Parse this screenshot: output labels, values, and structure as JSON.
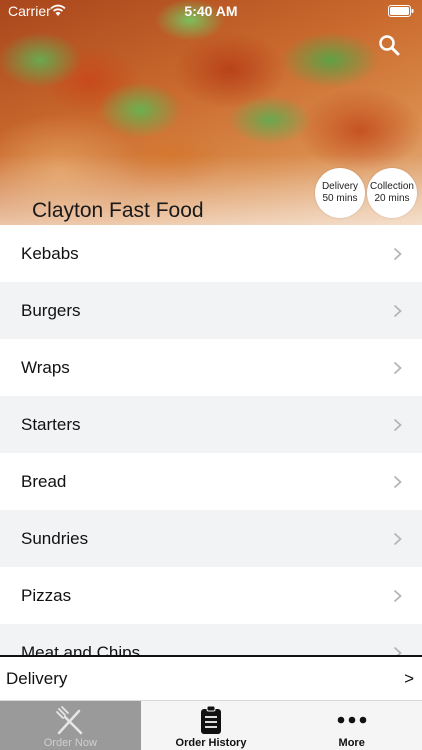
{
  "status_bar": {
    "carrier": "Carrier",
    "time": "5:40 AM"
  },
  "header": {
    "restaurant_name": "Clayton Fast Food",
    "search_icon": "search-icon",
    "delivery_badge": {
      "label": "Delivery",
      "time": "50 mins"
    },
    "collection_badge": {
      "label": "Collection",
      "time": "20 mins"
    }
  },
  "menu": {
    "items": [
      {
        "label": "Kebabs"
      },
      {
        "label": "Burgers"
      },
      {
        "label": "Wraps"
      },
      {
        "label": "Starters"
      },
      {
        "label": "Bread"
      },
      {
        "label": "Sundries"
      },
      {
        "label": "Pizzas"
      },
      {
        "label": "Meat and Chips"
      }
    ]
  },
  "order_type": {
    "label": "Delivery",
    "arrow": ">"
  },
  "tabs": [
    {
      "label": "Order Now",
      "icon": "fork-knife-icon",
      "active": true
    },
    {
      "label": "Order History",
      "icon": "clipboard-icon",
      "active": false
    },
    {
      "label": "More",
      "icon": "more-dots-icon",
      "active": false
    }
  ],
  "colors": {
    "alt_row": "#f2f3f5",
    "tab_active_bg": "#9a9a9a",
    "text": "#111111"
  }
}
